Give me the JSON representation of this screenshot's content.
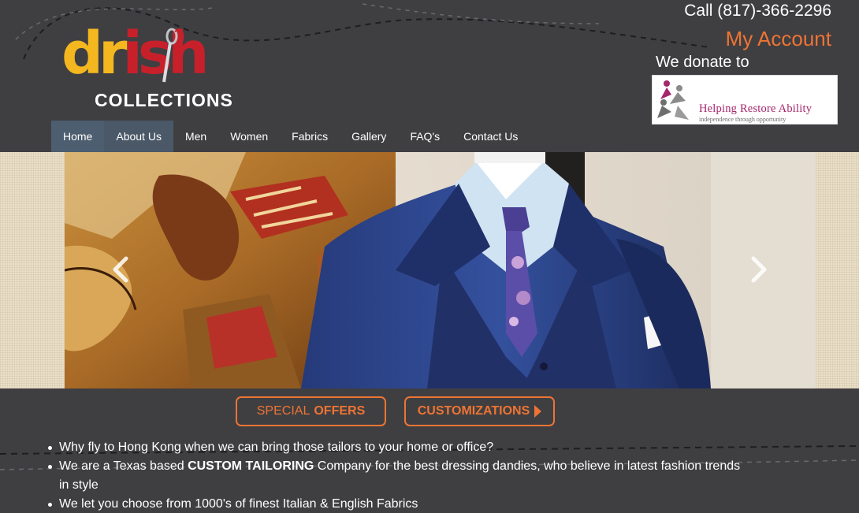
{
  "header": {
    "logo": {
      "word_left": "dr",
      "word_right": "ish",
      "subtitle": "COLLECTIONS"
    },
    "phone": "Call (817)-366-2296",
    "account_link": "My Account",
    "donate_text": "We donate to",
    "charity": {
      "name": "Helping Restore Ability",
      "tagline": "independence through opportunity"
    }
  },
  "nav": {
    "items": [
      {
        "label": "Home"
      },
      {
        "label": "About Us"
      },
      {
        "label": "Men"
      },
      {
        "label": "Women"
      },
      {
        "label": "Fabrics"
      },
      {
        "label": "Gallery"
      },
      {
        "label": "FAQ's"
      },
      {
        "label": "Contact Us"
      }
    ]
  },
  "hero": {
    "prev_icon": "chevron-left-icon",
    "next_icon": "chevron-right-icon"
  },
  "cta": {
    "offers_thin": "SPECIAL",
    "offers_bold": "OFFERS",
    "customizations": "CUSTOMIZATIONS"
  },
  "bullets": {
    "b1": "Why fly to Hong Kong when we can bring those tailors to your home or office?",
    "b2_pre": "We are a Texas based ",
    "b2_bold": "CUSTOM TAILORING",
    "b2_post": " Company for the best dressing dandies, who believe in latest fashion trends in style",
    "b3": "We let you choose from 1000's of finest Italian & English Fabrics"
  },
  "colors": {
    "background": "#3f3f42",
    "accent_orange": "#ee7433",
    "nav_active": "#4c5e6f",
    "logo_yellow": "#f4b71f",
    "logo_red": "#c8202b",
    "charity_magenta": "#a6266c"
  }
}
